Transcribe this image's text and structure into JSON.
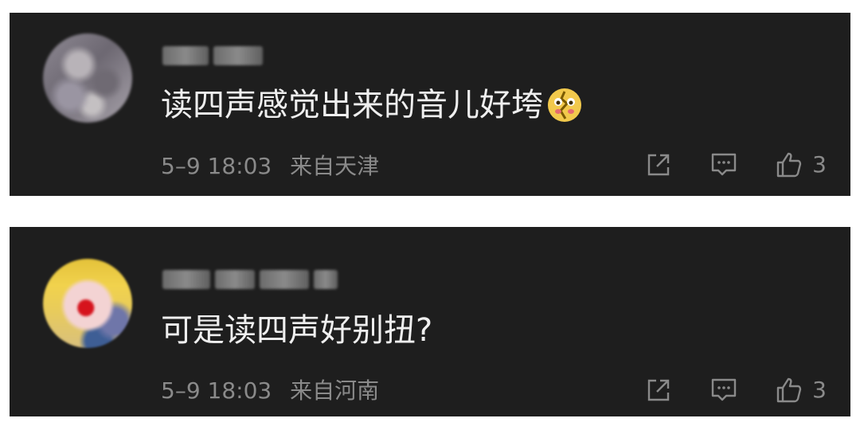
{
  "comments": [
    {
      "text": "读四声感觉出来的音儿好垮",
      "emoji": "broken-heart-face-emoji",
      "date": "5–9 18:03",
      "location": "来自天津",
      "likes": "3"
    },
    {
      "text": "可是读四声好别扭?",
      "date": "5–9 18:03",
      "location": "来自河南",
      "likes": "3"
    }
  ]
}
